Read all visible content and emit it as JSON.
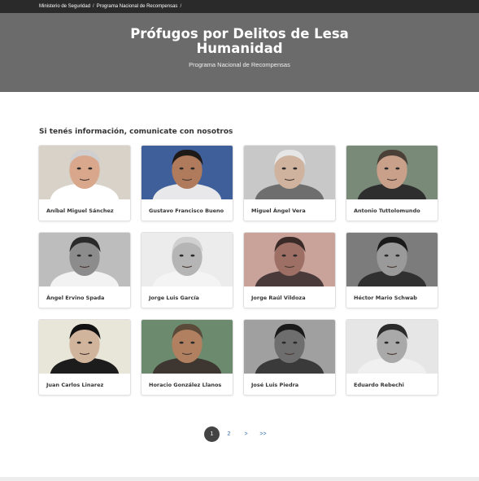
{
  "breadcrumb": {
    "items": [
      "Ministerio de Seguridad",
      "Programa Nacional de Recompensas"
    ],
    "separator": "/"
  },
  "hero": {
    "title": "Prófugos por Delitos de Lesa Humanidad",
    "subtitle": "Programa Nacional de Recompensas"
  },
  "section": {
    "title": "Si tenés información, comunicate con nosotros"
  },
  "cards": [
    {
      "name": "Aníbal Miguel Sánchez",
      "bg": "#d8d2c8",
      "skin": "#d9a88c",
      "hair": "#cfcfcf",
      "shirt": "#ffffff"
    },
    {
      "name": "Gustavo Francisco Bueno",
      "bg": "#3f5f9a",
      "skin": "#b07a5c",
      "hair": "#1e1a18",
      "shirt": "#e8e8ea"
    },
    {
      "name": "Miguel Ángel Vera",
      "bg": "#c8c8c8",
      "skin": "#cfb39f",
      "hair": "#e6e6e6",
      "shirt": "#6e6e6e"
    },
    {
      "name": "Antonio Tuttolomundo",
      "bg": "#7a8a78",
      "skin": "#c9a08a",
      "hair": "#4a4038",
      "shirt": "#2e2e2e"
    },
    {
      "name": "Ángel Ervino Spada",
      "bg": "#bdbdbd",
      "skin": "#8c8c8c",
      "hair": "#2a2a2a",
      "shirt": "#f2f2f2"
    },
    {
      "name": "Jorge Luis García",
      "bg": "#ececec",
      "skin": "#b5b5b5",
      "hair": "#d0d0d0",
      "shirt": "#f4f4f4"
    },
    {
      "name": "Jorge Raúl Vildoza",
      "bg": "#c9a39a",
      "skin": "#9e6f64",
      "hair": "#3a2a28",
      "shirt": "#4a3a3a"
    },
    {
      "name": "Héctor Mario Schwab",
      "bg": "#7c7c7c",
      "skin": "#9a9a9a",
      "hair": "#1a1a1a",
      "shirt": "#303030"
    },
    {
      "name": "Juan Carlos Linarez",
      "bg": "#e8e6d8",
      "skin": "#d1b49c",
      "hair": "#121212",
      "shirt": "#1c1c1c"
    },
    {
      "name": "Horacio González Llanos",
      "bg": "#6b8a6e",
      "skin": "#b08060",
      "hair": "#5b4a3a",
      "shirt": "#3e3630"
    },
    {
      "name": "José Luis Piedra",
      "bg": "#a0a0a0",
      "skin": "#6e6e6e",
      "hair": "#1a1a1a",
      "shirt": "#3a3a3a"
    },
    {
      "name": "Eduardo Rebechi",
      "bg": "#e6e6e6",
      "skin": "#a9a9a9",
      "hair": "#2b2b2b",
      "shirt": "#f0f0f0"
    }
  ],
  "pagination": {
    "pages": [
      "1",
      "2"
    ],
    "current": "1",
    "next": ">",
    "last": ">>"
  }
}
